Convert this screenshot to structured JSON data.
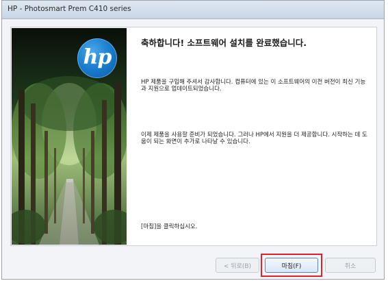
{
  "window": {
    "title": "HP - Photosmart Prem C410 series"
  },
  "logo": {
    "text": "hp"
  },
  "content": {
    "heading": "축하합니다! 소프트웨어 설치를 완료했습니다.",
    "paragraph1": "HP 제품을 구입해 주셔서 감사합니다. 컴퓨터에 있는 이 소프트웨어의 이전 버전이 최신 기능과 지원으로 업데이트되었습니다.",
    "paragraph2": "이제 제품을 사용할 준비가 되었습니다. 그러나 HP에서 지원을 더 제공합니다. 시작하는 데 도움이 되는 화면이 추가로 나타날 수 있습니다.",
    "instruction": "[마침]을 클릭하십시오."
  },
  "buttons": {
    "back": "< 뒤로(B)",
    "finish": "마침(F)",
    "cancel": "취소"
  },
  "colors": {
    "highlight": "#e0202a",
    "logo": "#1c7fd0"
  }
}
